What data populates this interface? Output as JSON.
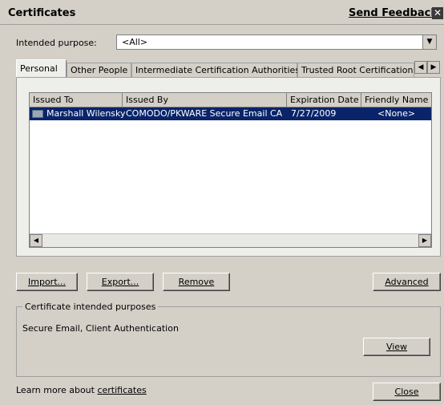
{
  "title": "Certificates",
  "send_feedback": "Send Feedback",
  "close_glyph": "✕",
  "intended_purpose": {
    "label": "Intended purpose:",
    "value": "<All>"
  },
  "tabs": [
    {
      "label": "Personal",
      "active": true
    },
    {
      "label": "Other People"
    },
    {
      "label": "Intermediate Certification Authorities"
    },
    {
      "label": "Trusted Root Certification"
    }
  ],
  "columns": [
    "Issued To",
    "Issued By",
    "Expiration Date",
    "Friendly Name"
  ],
  "rows": [
    {
      "issued_to": "Marshall Wilensky",
      "issued_by": "COMODO/PKWARE Secure Email CA",
      "expiration": "7/27/2009",
      "friendly_name": "<None>"
    }
  ],
  "buttons": {
    "import": "Import...",
    "export": "Export...",
    "remove": "Remove",
    "advanced": "Advanced",
    "view": "View",
    "close": "Close"
  },
  "purposes_group": {
    "label": "Certificate intended purposes",
    "value": "Secure Email, Client Authentication"
  },
  "learn_more": {
    "prefix": "Learn more about ",
    "link": "certificates"
  }
}
